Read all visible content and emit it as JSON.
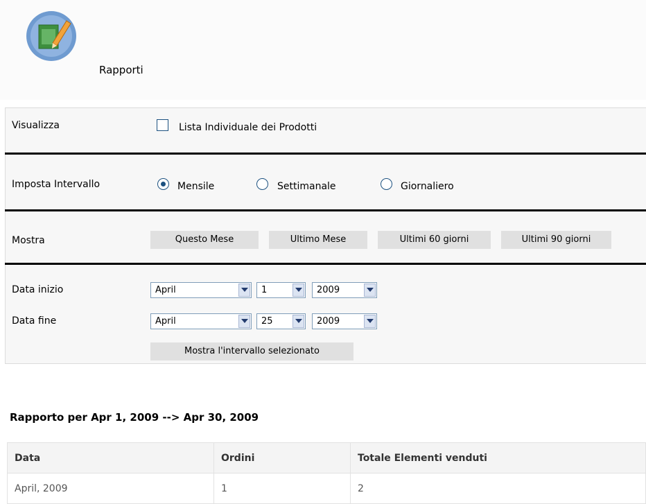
{
  "page": {
    "title": "Rapporti"
  },
  "filters": {
    "visualizza": {
      "label": "Visualizza",
      "checkbox_label": "Lista Individuale dei Prodotti",
      "checked": false
    },
    "intervallo": {
      "label": "Imposta Intervallo",
      "options": [
        {
          "label": "Mensile",
          "selected": true
        },
        {
          "label": "Settimanale",
          "selected": false
        },
        {
          "label": "Giornaliero",
          "selected": false
        }
      ]
    },
    "mostra": {
      "label": "Mostra",
      "buttons": [
        "Questo Mese",
        "Ultimo Mese",
        "Ultimi 60 giorni",
        "Ultimi 90 giorni"
      ]
    },
    "data_inizio": {
      "label": "Data inizio",
      "month": "April",
      "day": "1",
      "year": "2009"
    },
    "data_fine": {
      "label": "Data fine",
      "month": "April",
      "day": "25",
      "year": "2009"
    },
    "apply_label": "Mostra l'intervallo selezionato"
  },
  "report": {
    "title": "Rapporto per Apr 1, 2009 --> Apr 30, 2009",
    "columns": [
      "Data",
      "Ordini",
      "Totale Elementi venduti"
    ],
    "rows": [
      [
        "April, 2009",
        "1",
        "2"
      ]
    ]
  },
  "colors": {
    "accent": "#1c5180",
    "button_bg": "#e0e0e0",
    "panel_bg": "#f7f7f7"
  }
}
